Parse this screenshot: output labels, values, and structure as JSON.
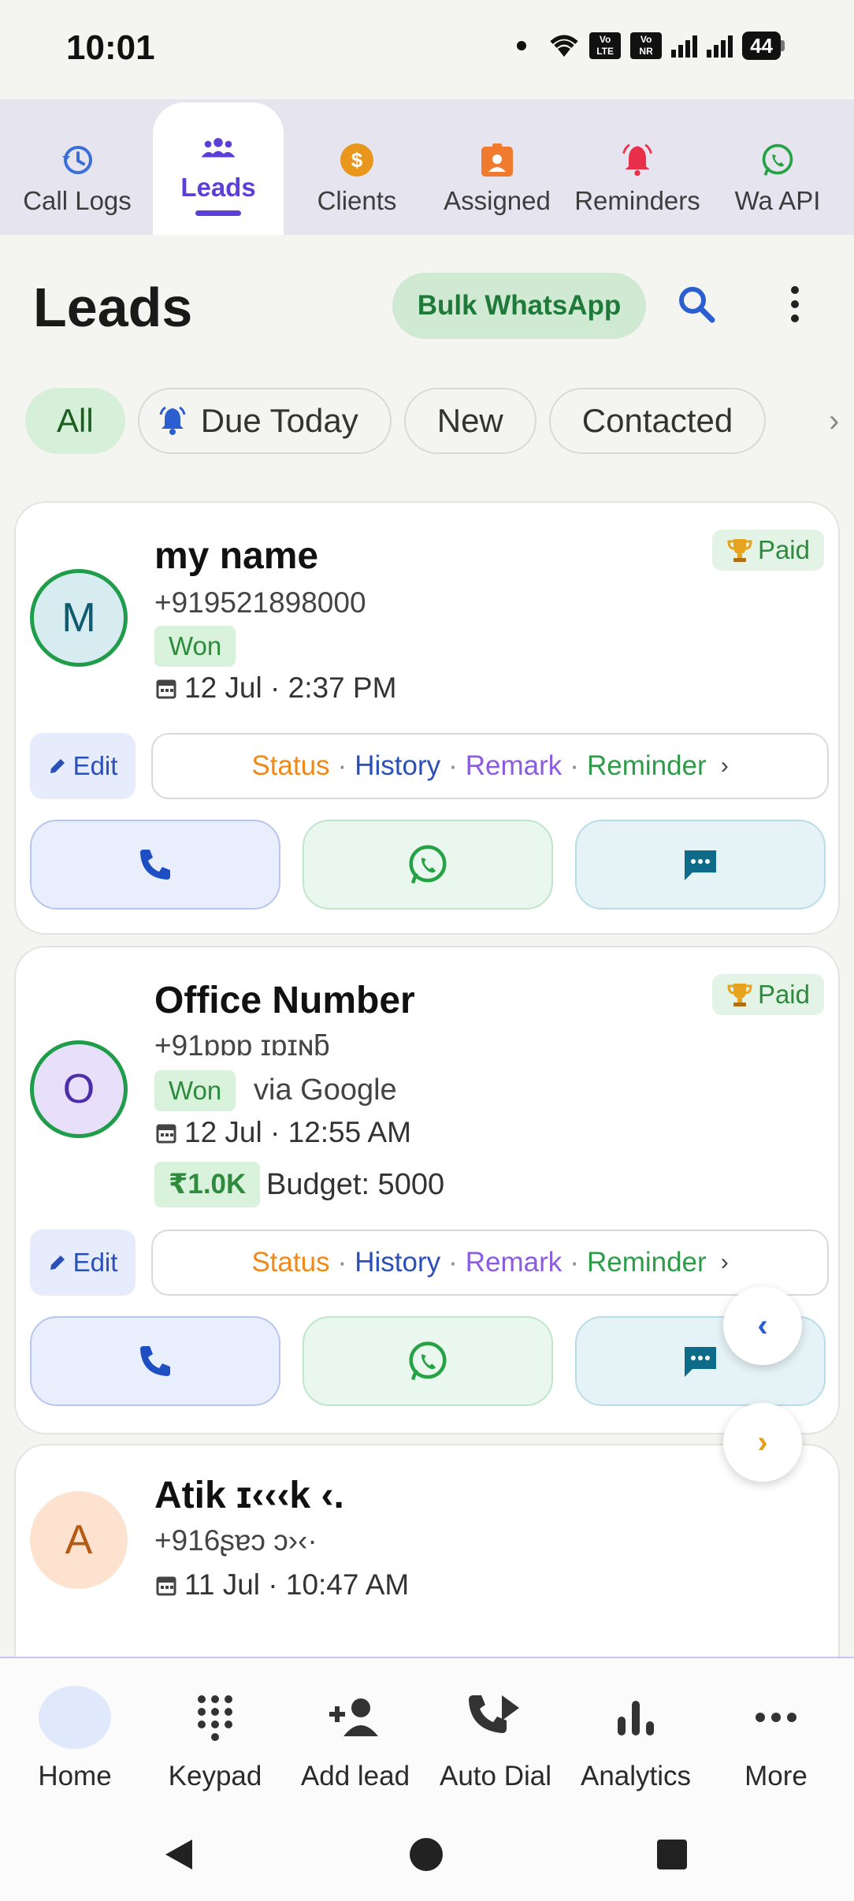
{
  "status_bar": {
    "time": "10:01",
    "sim1": "Vo LTE",
    "sim2": "Vo NR",
    "battery": "44"
  },
  "tabs": [
    {
      "label": "Call Logs",
      "icon": "history-icon",
      "active": false
    },
    {
      "label": "Leads",
      "icon": "people-icon",
      "active": true
    },
    {
      "label": "Clients",
      "icon": "dollar-coin-icon",
      "active": false
    },
    {
      "label": "Assigned",
      "icon": "badge-icon",
      "active": false
    },
    {
      "label": "Reminders",
      "icon": "bell-ring-icon",
      "active": false
    },
    {
      "label": "Wa API",
      "icon": "whatsapp-icon",
      "active": false
    }
  ],
  "header": {
    "title": "Leads",
    "bulk_button": "Bulk WhatsApp"
  },
  "filters": [
    "All",
    "Due Today",
    "New",
    "Contacted"
  ],
  "action_labels": {
    "edit": "Edit",
    "status": "Status",
    "history": "History",
    "remark": "Remark",
    "reminder": "Reminder"
  },
  "leads": [
    {
      "initial": "M",
      "name": "my name",
      "phone": "+919521898000",
      "status": "Won",
      "date": "12 Jul · 2:37 PM",
      "tag": "Paid",
      "accent": "#1f9d4a"
    },
    {
      "initial": "O",
      "name": "Office Number",
      "phone": "+91ɒɒɒ ɪɒɪɴƃ",
      "status": "Won",
      "source": "via Google",
      "date": "12 Jul · 12:55 AM",
      "tag": "Paid",
      "amount": "₹1.0K",
      "budget": "Budget: 5000",
      "accent": "#1f9d4a"
    },
    {
      "initial": "A",
      "name": "Atik ɪ‹‹‹k ‹.",
      "phone": "+916ʂɐɔ ɔ›‹·",
      "date": "11 Jul · 10:47 AM",
      "accent": "#e07a1f"
    }
  ],
  "bottom_nav": [
    {
      "label": "Home",
      "icon": "home-icon"
    },
    {
      "label": "Keypad",
      "icon": "keypad-icon"
    },
    {
      "label": "Add lead",
      "icon": "add-person-icon"
    },
    {
      "label": "Auto Dial",
      "icon": "auto-dial-icon"
    },
    {
      "label": "Analytics",
      "icon": "bar-chart-icon"
    },
    {
      "label": "More",
      "icon": "more-horizontal-icon"
    }
  ],
  "colors": {
    "accent": "#5b3fd6",
    "whatsapp": "#25a244",
    "call": "#1e4fc2"
  }
}
